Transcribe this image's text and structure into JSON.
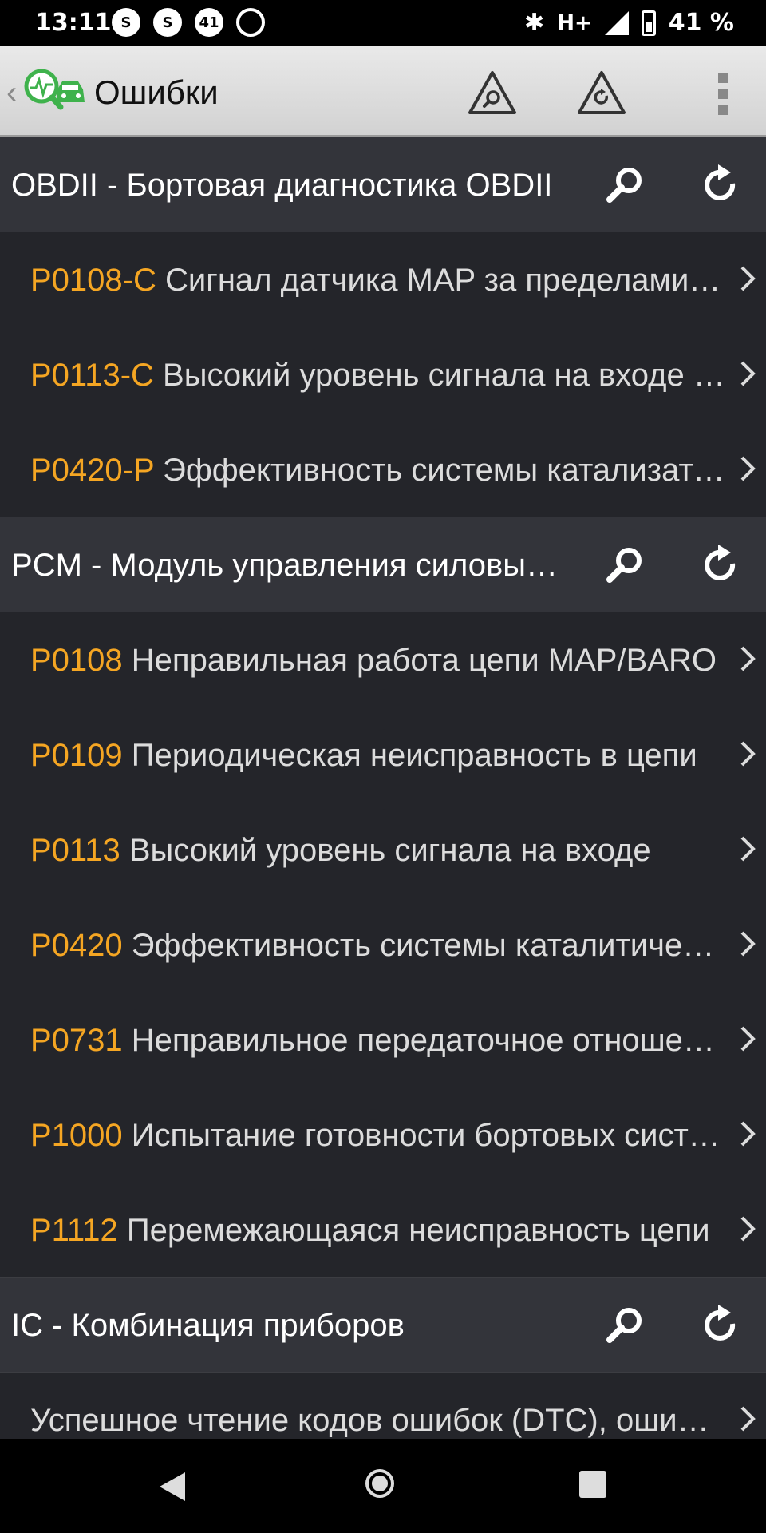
{
  "status_bar": {
    "time": "13:11",
    "notif_badge": "41",
    "network": "H+",
    "battery": "41 %"
  },
  "app_bar": {
    "title": "Ошибки",
    "icons": [
      "back-chevron-icon",
      "app-logo-icon",
      "diagnose-search-icon",
      "diagnose-refresh-icon",
      "overflow-menu-icon"
    ]
  },
  "groups": [
    {
      "title": "OBDII - Бортовая диагностика OBDII",
      "items": [
        {
          "code": "P0108-C",
          "desc": "Сигнал датчика MAP за пределами диапазона"
        },
        {
          "code": "P0113-C",
          "desc": "Высокий уровень сигнала на входе датчика"
        },
        {
          "code": "P0420-P",
          "desc": "Эффективность системы катализатора"
        }
      ]
    },
    {
      "title": "PCM - Модуль управления силовым агрегатом",
      "items": [
        {
          "code": "P0108",
          "desc": "Неправильная работа цепи MAP/BARO"
        },
        {
          "code": "P0109",
          "desc": "Периодическая неисправность в цепи"
        },
        {
          "code": "P0113",
          "desc": "Высокий уровень сигнала на входе"
        },
        {
          "code": "P0420",
          "desc": "Эффективность системы каталитического"
        },
        {
          "code": "P0731",
          "desc": "Неправильное передаточное отношение"
        },
        {
          "code": "P1000",
          "desc": "Испытание готовности бортовых систем"
        },
        {
          "code": "P1112",
          "desc": "Перемежающаяся неисправность цепи"
        }
      ]
    },
    {
      "title": "IC - Комбинация приборов",
      "items": [
        {
          "code": "",
          "desc": "Успешное чтение кодов ошибок (DTC), ошибок нет"
        }
      ]
    }
  ],
  "colors": {
    "code": "#f5a623",
    "group_bg": "#33343a",
    "item_bg": "#24252a",
    "appbar_bg": "#dedede"
  }
}
